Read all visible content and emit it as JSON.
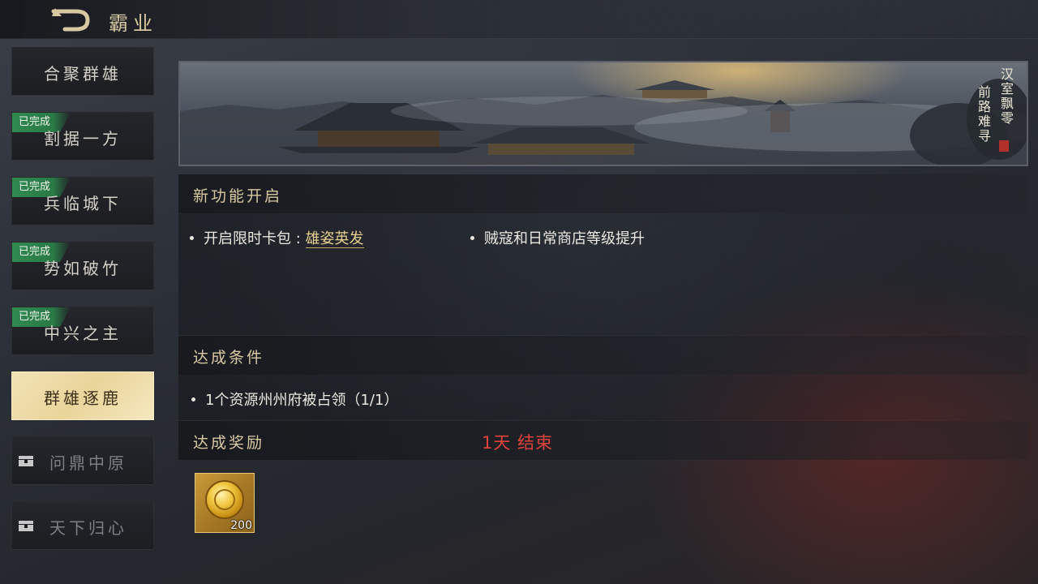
{
  "header": {
    "title": "霸业"
  },
  "sidebar": {
    "items": [
      {
        "label": "合聚群雄",
        "status": ""
      },
      {
        "label": "割据一方",
        "status": "已完成"
      },
      {
        "label": "兵临城下",
        "status": "已完成"
      },
      {
        "label": "势如破竹",
        "status": "已完成"
      },
      {
        "label": "中兴之主",
        "status": "已完成"
      },
      {
        "label": "群雄逐鹿",
        "status": "active"
      },
      {
        "label": "问鼎中原",
        "status": "locked"
      },
      {
        "label": "天下归心",
        "status": "locked"
      }
    ]
  },
  "banner": {
    "poem_line1": "汉室飘零",
    "poem_line2": "前路难寻"
  },
  "features": {
    "title": "新功能开启",
    "item1_prefix": "开启限时卡包 : ",
    "item1_link": "雄姿英发",
    "item2": "贼寇和日常商店等级提升"
  },
  "conditions": {
    "title": "达成条件",
    "item1": "1个资源州州府被占领（1/1）"
  },
  "rewards": {
    "title": "达成奖励",
    "timer": "1天 结束",
    "items": [
      {
        "icon": "gold-coin-icon",
        "count": "200"
      }
    ]
  },
  "colors": {
    "gold_text": "#d9c9a3",
    "done_tag": "#2f8a4f",
    "timer_red": "#e0433d",
    "active_tab": "#f2e3b6"
  }
}
